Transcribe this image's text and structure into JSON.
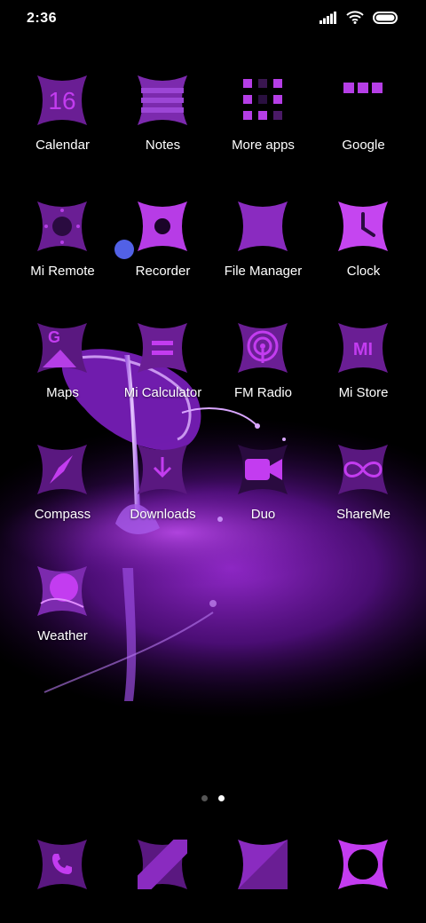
{
  "status": {
    "time": "2:36",
    "icons": [
      "signal-icon",
      "wifi-icon",
      "battery-icon"
    ]
  },
  "colors": {
    "accent": "#c33cf0",
    "accent_dark": "#5a1a78",
    "accent_mid": "#8b2bc0",
    "background": "#000000"
  },
  "apps": [
    {
      "label": "Calendar",
      "icon": "calendar-icon",
      "text": "16"
    },
    {
      "label": "Notes",
      "icon": "notes-icon"
    },
    {
      "label": "More apps",
      "icon": "folder-icon"
    },
    {
      "label": "Google",
      "icon": "google-folder-icon"
    },
    {
      "label": "Mi Remote",
      "icon": "remote-icon"
    },
    {
      "label": "Recorder",
      "icon": "recorder-icon"
    },
    {
      "label": "File Manager",
      "icon": "file-manager-icon"
    },
    {
      "label": "Clock",
      "icon": "clock-icon"
    },
    {
      "label": "Maps",
      "icon": "maps-icon",
      "text": "G"
    },
    {
      "label": "Mi Calculator",
      "icon": "calculator-icon"
    },
    {
      "label": "FM Radio",
      "icon": "radio-icon"
    },
    {
      "label": "Mi Store",
      "icon": "mi-store-icon",
      "text": "MI"
    },
    {
      "label": "Compass",
      "icon": "compass-icon"
    },
    {
      "label": "Downloads",
      "icon": "downloads-icon"
    },
    {
      "label": "Duo",
      "icon": "video-camera-icon"
    },
    {
      "label": "ShareMe",
      "icon": "infinity-icon"
    },
    {
      "label": "Weather",
      "icon": "weather-icon"
    }
  ],
  "page_indicator": {
    "count": 2,
    "active": 2
  },
  "dock": [
    {
      "icon": "phone-icon"
    },
    {
      "icon": "messages-icon"
    },
    {
      "icon": "browser-icon"
    },
    {
      "icon": "camera-icon"
    }
  ]
}
